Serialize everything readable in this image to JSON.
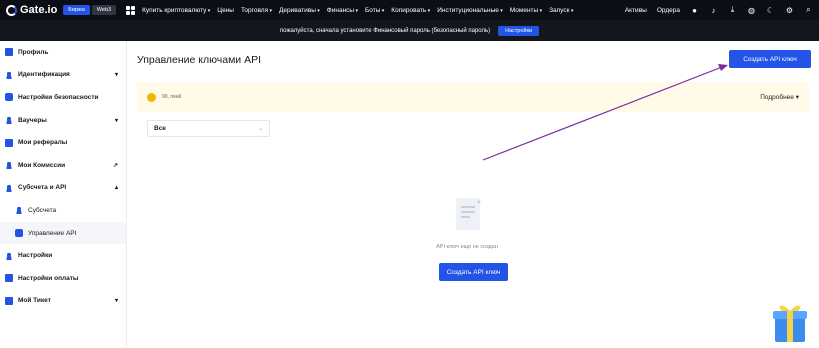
{
  "header": {
    "brand": "Gate.io",
    "tabs": [
      "Биржа",
      "Web3"
    ],
    "nav": [
      {
        "label": "Купить криптовалюту",
        "dropdown": true
      },
      {
        "label": "Цены",
        "dropdown": false
      },
      {
        "label": "Торговля",
        "dropdown": true
      },
      {
        "label": "Деривативы",
        "dropdown": true
      },
      {
        "label": "Финансы",
        "dropdown": true
      },
      {
        "label": "Боты",
        "dropdown": true
      },
      {
        "label": "Копировать",
        "dropdown": true
      },
      {
        "label": "Институциональные",
        "dropdown": true
      },
      {
        "label": "Моменты",
        "dropdown": true
      },
      {
        "label": "Запуск",
        "dropdown": true
      }
    ],
    "right": {
      "assets": "Активы",
      "orders": "Ордера"
    }
  },
  "banner": {
    "text": "пожалуйста, сначала установите Финансовый пароль (безопасный пароль)",
    "button": "Настройки"
  },
  "sidebar": {
    "items": [
      {
        "label": "Профиль",
        "chevron": ""
      },
      {
        "label": "Идентификация",
        "chevron": "▾"
      },
      {
        "label": "Настройки безопасности",
        "chevron": ""
      },
      {
        "label": "Ваучеры",
        "chevron": "▾"
      },
      {
        "label": "Мои рефералы",
        "chevron": ""
      },
      {
        "label": "Мои Комиссии",
        "chevron": "↗"
      },
      {
        "label": "Субсчета и API",
        "chevron": "▴"
      },
      {
        "label": "Субсчета",
        "chevron": ""
      },
      {
        "label": "Управление API",
        "chevron": ""
      },
      {
        "label": "Настройки",
        "chevron": ""
      },
      {
        "label": "Настройки оплаты",
        "chevron": ""
      },
      {
        "label": "Мой Тикет",
        "chevron": "▾"
      }
    ]
  },
  "main": {
    "title": "Управление ключами API",
    "create_button": "Создать API ключ",
    "notice": {
      "points": "90, гмнй",
      "more": "Подробнее"
    },
    "filter": {
      "value": "Все"
    },
    "empty": {
      "text": "API ключ еще не создан",
      "button": "Создать API ключ"
    }
  },
  "colors": {
    "accent": "#2354e6",
    "annotation_arrow": "#7a2a9c"
  }
}
